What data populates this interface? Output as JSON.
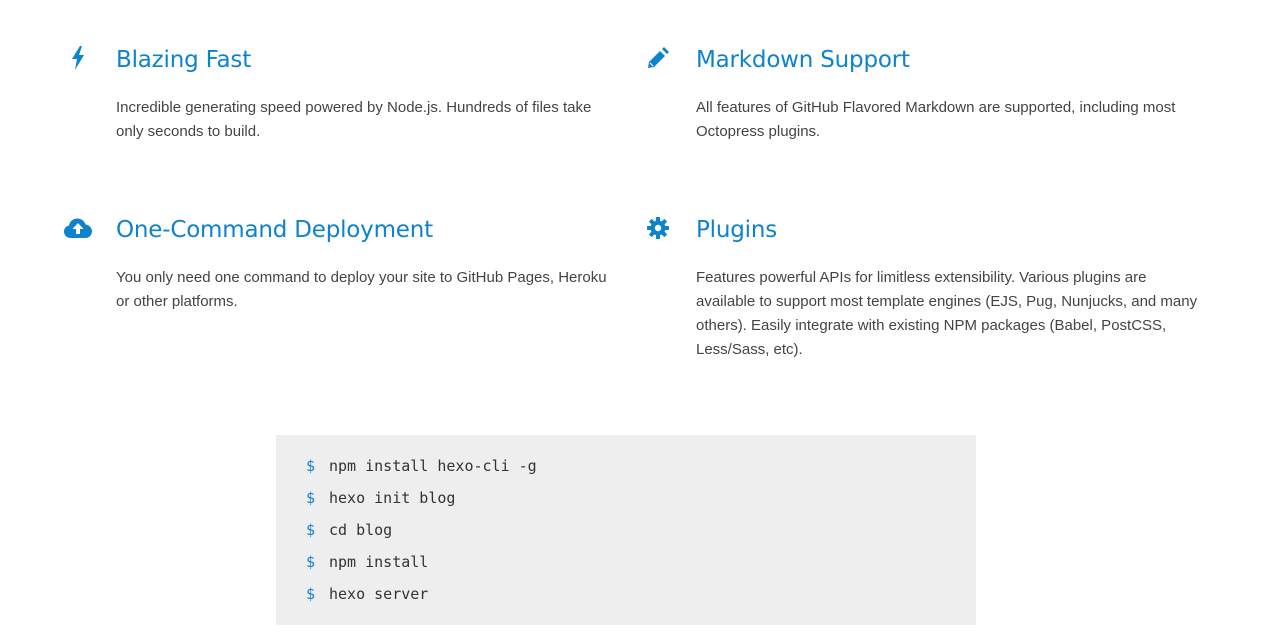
{
  "features": [
    {
      "icon": "bolt-icon",
      "title": "Blazing Fast",
      "description": "Incredible generating speed powered by Node.js. Hundreds of files take only seconds to build."
    },
    {
      "icon": "pencil-icon",
      "title": "Markdown Support",
      "description": "All features of GitHub Flavored Markdown are supported, including most Octopress plugins."
    },
    {
      "icon": "cloud-upload-icon",
      "title": "One-Command Deployment",
      "description": "You only need one command to deploy your site to GitHub Pages, Heroku or other platforms."
    },
    {
      "icon": "gear-icon",
      "title": "Plugins",
      "description": "Features powerful APIs for limitless extensibility. Various plugins are available to support most template engines (EJS, Pug, Nunjucks, and many others). Easily integrate with existing NPM packages (Babel, PostCSS, Less/Sass, etc)."
    }
  ],
  "terminal": {
    "prompt": "$",
    "commands": [
      "npm install hexo-cli -g",
      "hexo init blog",
      "cd blog",
      "npm install",
      "hexo server"
    ]
  },
  "colors": {
    "accent": "#0e83cd",
    "text": "#444444",
    "terminal_bg": "#eeeeee"
  }
}
